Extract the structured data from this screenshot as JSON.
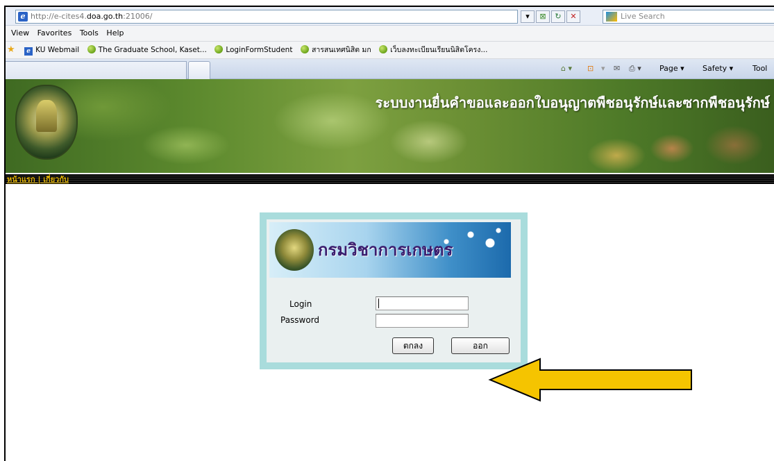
{
  "browser": {
    "url_prefix": "http://e-cites4.",
    "url_domain": "doa.go.th",
    "url_suffix": ":21006/",
    "search_placeholder": "Live Search",
    "menu": [
      "View",
      "Favorites",
      "Tools",
      "Help"
    ],
    "favorites": [
      "KU Webmail",
      "The Graduate School, Kaset...",
      "LoginFormStudent",
      "สารสนเทศนิสิต มก",
      "เว็บลงทะเบียนเรียนนิสิตโครง..."
    ],
    "command_bar": {
      "page": "Page ▾",
      "safety": "Safety ▾",
      "tools": "Tool"
    }
  },
  "site": {
    "banner_title": "ระบบงานยื่นคำขอและออกใบอนุญาตพืชอนุรักษ์และซากพืชอนุรักษ์",
    "nav_home": "หน้าแรก",
    "nav_sep": " | ",
    "nav_about": "เกี่ยวกับ"
  },
  "login": {
    "brand": "กรมวิชาการเกษตร",
    "login_label": "Login",
    "password_label": "Password",
    "login_value": "",
    "password_value": "",
    "ok_button": "ตกลง",
    "exit_button": "ออก"
  },
  "colors": {
    "login_border": "#a9dcdc",
    "arrow_fill": "#f5c400",
    "nav_link": "#e0b000"
  }
}
